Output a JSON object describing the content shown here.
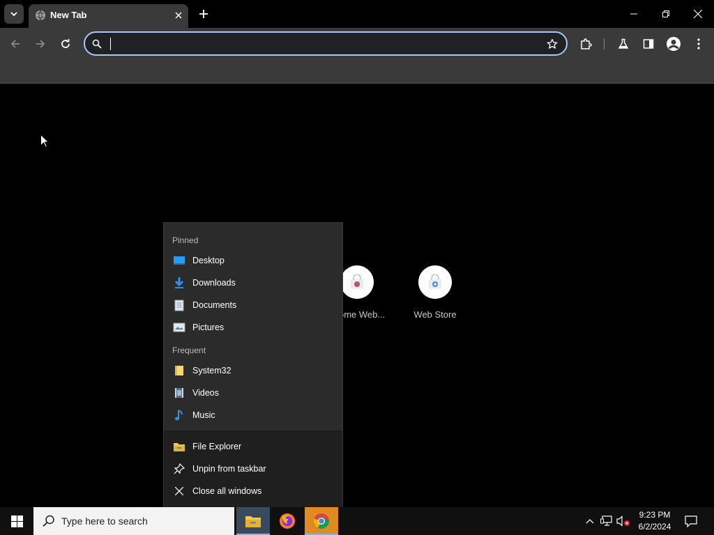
{
  "browser": {
    "tab": {
      "title": "New Tab"
    },
    "omnibox": {
      "value": "",
      "placeholder": ""
    }
  },
  "shortcuts": [
    {
      "label": "ome Web..."
    },
    {
      "label": "Web Store"
    }
  ],
  "jumplist": {
    "pinned_header": "Pinned",
    "pinned": [
      {
        "label": "Desktop",
        "icon": "desktop-folder-icon"
      },
      {
        "label": "Downloads",
        "icon": "downloads-folder-icon"
      },
      {
        "label": "Documents",
        "icon": "documents-folder-icon"
      },
      {
        "label": "Pictures",
        "icon": "pictures-folder-icon"
      }
    ],
    "frequent_header": "Frequent",
    "frequent": [
      {
        "label": "System32",
        "icon": "folder-icon"
      },
      {
        "label": "Videos",
        "icon": "videos-folder-icon"
      },
      {
        "label": "Music",
        "icon": "music-folder-icon"
      }
    ],
    "tasks": [
      {
        "label": "File Explorer",
        "icon": "file-explorer-icon"
      },
      {
        "label": "Unpin from taskbar",
        "icon": "unpin-icon"
      },
      {
        "label": "Close all windows",
        "icon": "close-icon"
      }
    ]
  },
  "taskbar": {
    "search_placeholder": "Type here to search",
    "time": "9:23 PM",
    "date": "6/2/2024"
  },
  "colors": {
    "accent": "#a8c7fa",
    "taskbar_bg": "#101010",
    "chrome_active_app": "#e08a24"
  }
}
